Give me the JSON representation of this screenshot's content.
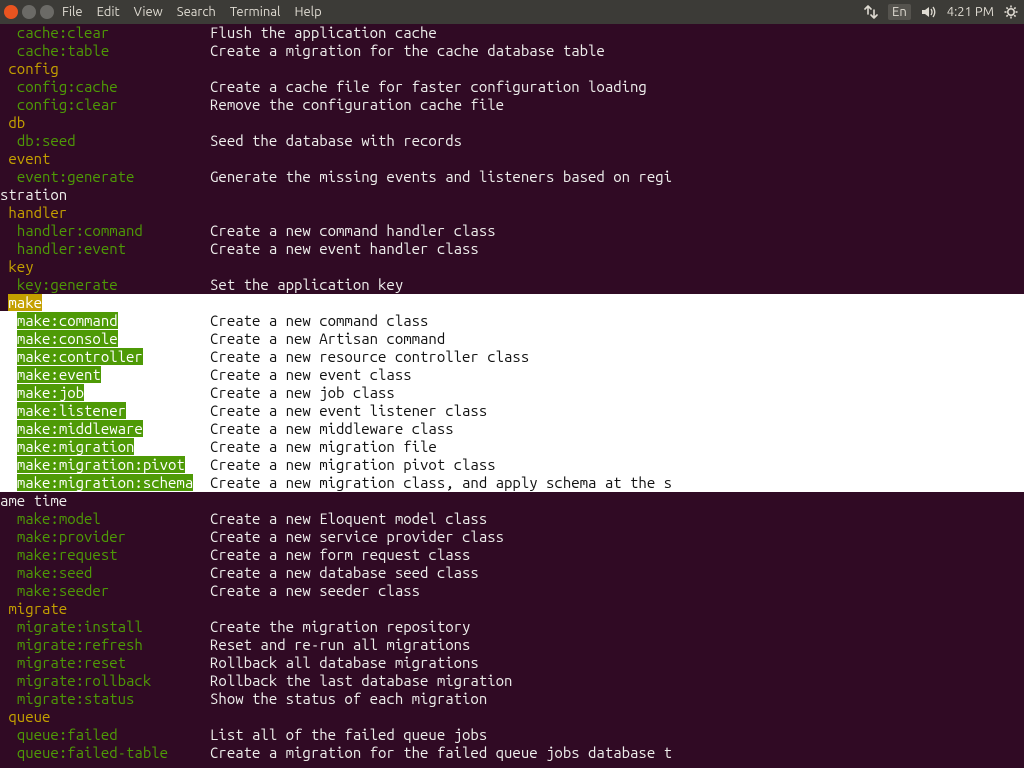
{
  "menubar": {
    "items": [
      "File",
      "Edit",
      "View",
      "Search",
      "Terminal",
      "Help"
    ],
    "tray": {
      "lang": "En",
      "time": "4:21 PM"
    }
  },
  "colLeft": 2,
  "colDesc": 25,
  "width": 108,
  "lines": [
    {
      "type": "cmd",
      "cmd": "cache:clear",
      "desc": "Flush the application cache",
      "hl": false
    },
    {
      "type": "cmd",
      "cmd": "cache:table",
      "desc": "Create a migration for the cache database table",
      "hl": false
    },
    {
      "type": "group",
      "label": "config",
      "hl": false
    },
    {
      "type": "cmd",
      "cmd": "config:cache",
      "desc": "Create a cache file for faster configuration loading",
      "hl": false
    },
    {
      "type": "cmd",
      "cmd": "config:clear",
      "desc": "Remove the configuration cache file",
      "hl": false
    },
    {
      "type": "group",
      "label": "db",
      "hl": false
    },
    {
      "type": "cmd",
      "cmd": "db:seed",
      "desc": "Seed the database with records",
      "hl": false
    },
    {
      "type": "group",
      "label": "event",
      "hl": false
    },
    {
      "type": "cmd",
      "cmd": "event:generate",
      "desc": "Generate the missing events and listeners based on regi",
      "hl": false,
      "wrap": "stration"
    },
    {
      "type": "group",
      "label": "handler",
      "hl": false
    },
    {
      "type": "cmd",
      "cmd": "handler:command",
      "desc": "Create a new command handler class",
      "hl": false
    },
    {
      "type": "cmd",
      "cmd": "handler:event",
      "desc": "Create a new event handler class",
      "hl": false
    },
    {
      "type": "group",
      "label": "key",
      "hl": false
    },
    {
      "type": "cmd",
      "cmd": "key:generate",
      "desc": "Set the application key",
      "hl": false
    },
    {
      "type": "make_header",
      "label": "make"
    },
    {
      "type": "cmd",
      "cmd": "make:command",
      "desc": "Create a new command class",
      "hl": true
    },
    {
      "type": "cmd",
      "cmd": "make:console",
      "desc": "Create a new Artisan command",
      "hl": true
    },
    {
      "type": "cmd",
      "cmd": "make:controller",
      "desc": "Create a new resource controller class",
      "hl": true
    },
    {
      "type": "cmd",
      "cmd": "make:event",
      "desc": "Create a new event class",
      "hl": true
    },
    {
      "type": "cmd",
      "cmd": "make:job",
      "desc": "Create a new job class",
      "hl": true
    },
    {
      "type": "cmd",
      "cmd": "make:listener",
      "desc": "Create a new event listener class",
      "hl": true
    },
    {
      "type": "cmd",
      "cmd": "make:middleware",
      "desc": "Create a new middleware class",
      "hl": true
    },
    {
      "type": "cmd",
      "cmd": "make:migration",
      "desc": "Create a new migration file",
      "hl": true
    },
    {
      "type": "cmd",
      "cmd": "make:migration:pivot",
      "desc": "Create a new migration pivot class",
      "hl": true
    },
    {
      "type": "cmd",
      "cmd": "make:migration:schema",
      "desc": "Create a new migration class, and apply schema at the s",
      "hl": true,
      "wrap": "ame time"
    },
    {
      "type": "cmd",
      "cmd": "make:model",
      "desc": "Create a new Eloquent model class",
      "hl": false
    },
    {
      "type": "cmd",
      "cmd": "make:provider",
      "desc": "Create a new service provider class",
      "hl": false
    },
    {
      "type": "cmd",
      "cmd": "make:request",
      "desc": "Create a new form request class",
      "hl": false
    },
    {
      "type": "cmd",
      "cmd": "make:seed",
      "desc": "Create a new database seed class",
      "hl": false
    },
    {
      "type": "cmd",
      "cmd": "make:seeder",
      "desc": "Create a new seeder class",
      "hl": false
    },
    {
      "type": "group",
      "label": "migrate",
      "hl": false
    },
    {
      "type": "cmd",
      "cmd": "migrate:install",
      "desc": "Create the migration repository",
      "hl": false
    },
    {
      "type": "cmd",
      "cmd": "migrate:refresh",
      "desc": "Reset and re-run all migrations",
      "hl": false
    },
    {
      "type": "cmd",
      "cmd": "migrate:reset",
      "desc": "Rollback all database migrations",
      "hl": false
    },
    {
      "type": "cmd",
      "cmd": "migrate:rollback",
      "desc": "Rollback the last database migration",
      "hl": false
    },
    {
      "type": "cmd",
      "cmd": "migrate:status",
      "desc": "Show the status of each migration",
      "hl": false
    },
    {
      "type": "group",
      "label": "queue",
      "hl": false
    },
    {
      "type": "cmd",
      "cmd": "queue:failed",
      "desc": "List all of the failed queue jobs",
      "hl": false
    },
    {
      "type": "cmd",
      "cmd": "queue:failed-table",
      "desc": "Create a migration for the failed queue jobs database t",
      "hl": false
    }
  ]
}
